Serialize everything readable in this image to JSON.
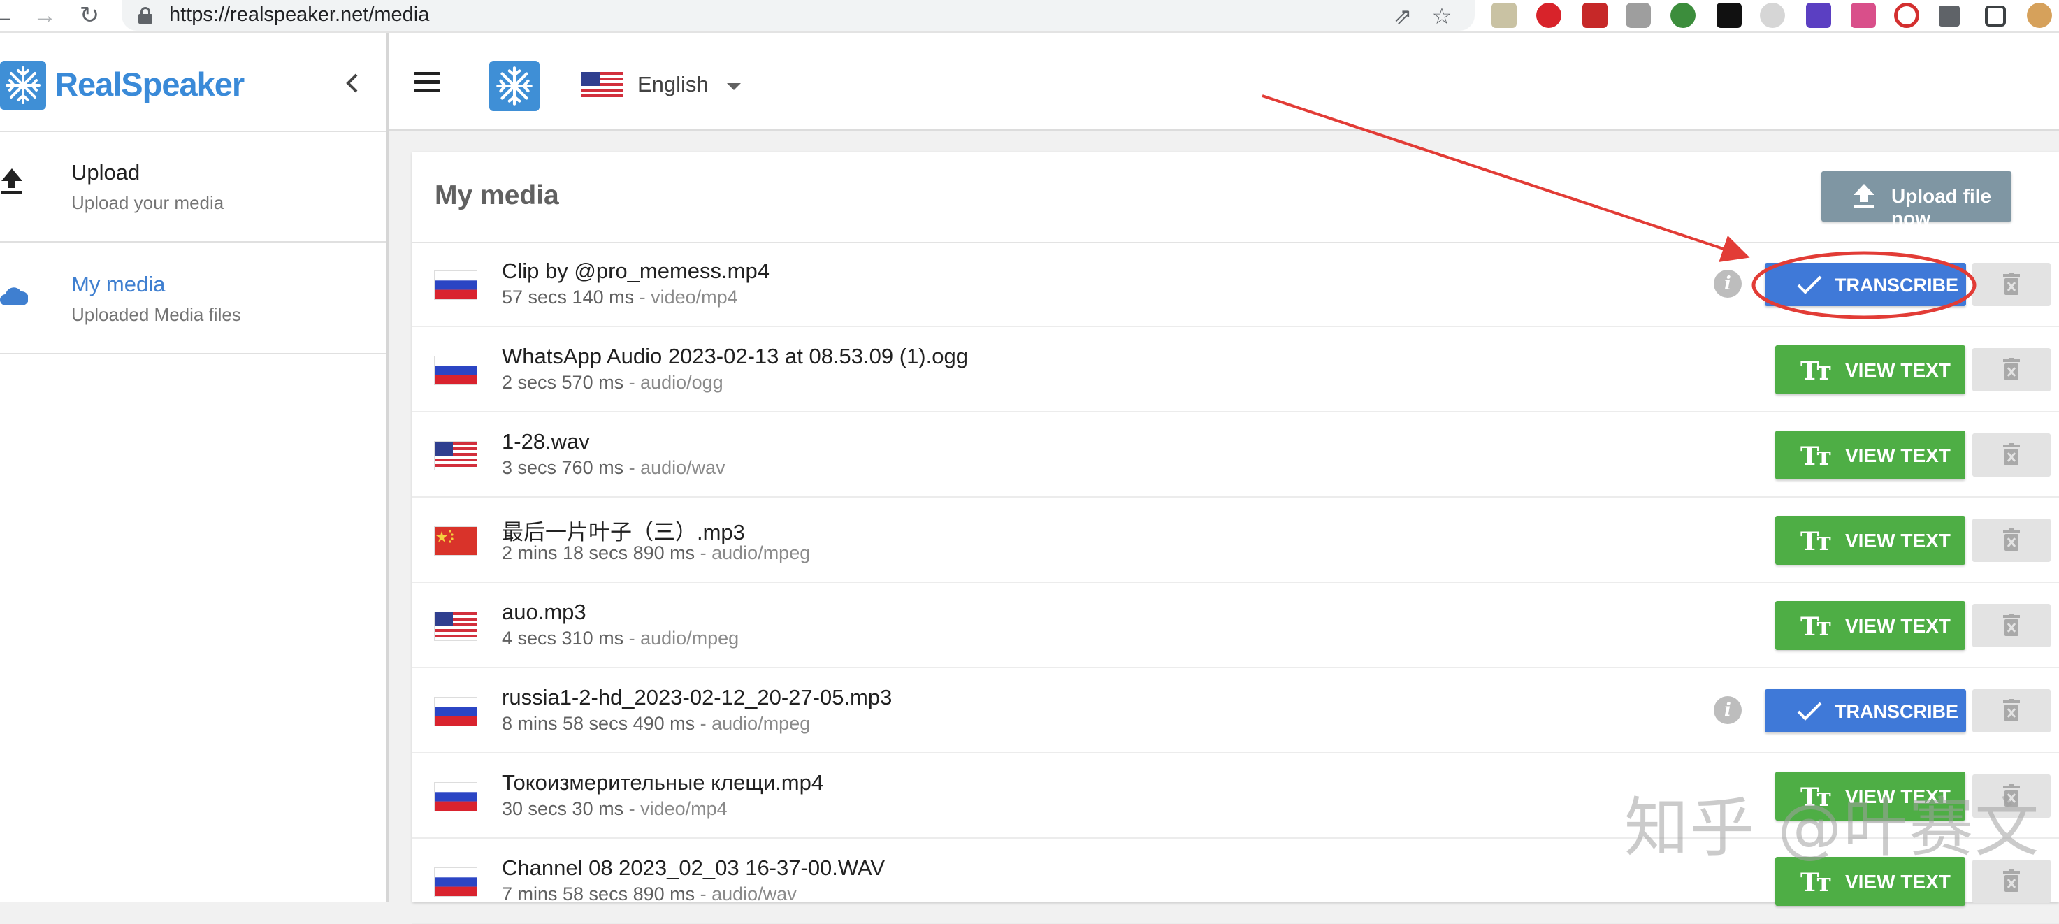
{
  "browser": {
    "url": "https://realspeaker.net/media"
  },
  "app": {
    "brand_name": "RealSpeaker",
    "brand_color": "#3a8ad8"
  },
  "sidebar": {
    "items": [
      {
        "title": "Upload",
        "subtitle": "Upload your media",
        "icon": "upload-icon",
        "active": false
      },
      {
        "title": "My media",
        "subtitle": "Uploaded Media files",
        "icon": "cloud-icon",
        "active": true
      }
    ]
  },
  "header": {
    "language": "English",
    "language_flag": "us"
  },
  "media": {
    "title": "My media",
    "upload_button": "Upload file now",
    "transcribe_label": "TRANSCRIBE",
    "view_text_label": "VIEW TEXT",
    "items": [
      {
        "name": "Clip by @pro_memess.mp4",
        "duration": "57 secs 140 ms",
        "mime": "video/mp4",
        "flag": "ru",
        "action": "transcribe"
      },
      {
        "name": "WhatsApp Audio 2023-02-13 at 08.53.09 (1).ogg",
        "duration": "2 secs 570 ms",
        "mime": "audio/ogg",
        "flag": "ru",
        "action": "view"
      },
      {
        "name": "1-28.wav",
        "duration": "3 secs 760 ms",
        "mime": "audio/wav",
        "flag": "us",
        "action": "view"
      },
      {
        "name": "最后一片叶子（三）.mp3",
        "duration": "2 mins 18 secs 890 ms",
        "mime": "audio/mpeg",
        "flag": "cn",
        "action": "view"
      },
      {
        "name": "auo.mp3",
        "duration": "4 secs 310 ms",
        "mime": "audio/mpeg",
        "flag": "us",
        "action": "view"
      },
      {
        "name": "russia1-2-hd_2023-02-12_20-27-05.mp3",
        "duration": "8 mins 58 secs 490 ms",
        "mime": "audio/mpeg",
        "flag": "ru",
        "action": "transcribe"
      },
      {
        "name": "Токоизмерительные клещи.mp4",
        "duration": "30 secs 30 ms",
        "mime": "video/mp4",
        "flag": "ru",
        "action": "view"
      },
      {
        "name": "Channel 08 2023_02_03 16-37-00.WAV",
        "duration": "7 mins 58 secs 890 ms",
        "mime": "audio/wav",
        "flag": "ru",
        "action": "view"
      }
    ]
  },
  "watermark": "知乎 @叶赛文",
  "colors": {
    "transcribe": "#3f79d8",
    "view_text": "#4eae45",
    "upload_button": "#7f96a3",
    "annotation": "#e23c36"
  }
}
